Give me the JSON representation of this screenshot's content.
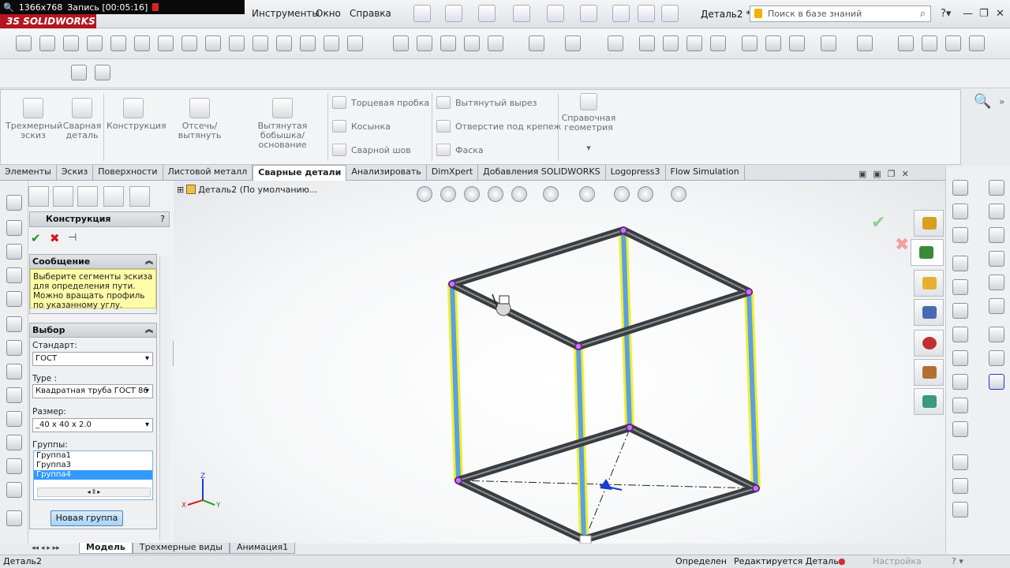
{
  "recorder": {
    "resolution": "1366x768",
    "record_label": "Запись [00:05:16]"
  },
  "app": {
    "brand": "3S SOLIDWORKS"
  },
  "menu": [
    "Инструменты",
    "Окно",
    "Справка"
  ],
  "doc_title": "Деталь2 *",
  "search": {
    "placeholder": "Поиск в базе знаний"
  },
  "command_manager": {
    "big_buttons": [
      {
        "label": "Трехмерный эскиз"
      },
      {
        "label": "Сварная деталь"
      },
      {
        "label": "Конструкция"
      },
      {
        "label": "Отсечь/вытянуть"
      },
      {
        "label": "Вытянутая бобышка/основание"
      }
    ],
    "col1": [
      "Торцевая пробка",
      "Косынка",
      "Сварной шов"
    ],
    "col2": [
      "Вытянутый вырез",
      "Отверстие под крепеж",
      "Фаска"
    ],
    "ref_geom": "Справочная геометрия"
  },
  "tabs": [
    "Элементы",
    "Эскиз",
    "Поверхности",
    "Листовой металл",
    "Сварные детали",
    "Анализировать",
    "DimXpert",
    "Добавления SOLIDWORKS",
    "Logopress3",
    "Flow Simulation"
  ],
  "active_tab": "Сварные детали",
  "property_manager": {
    "title": "Конструкция",
    "message_header": "Сообщение",
    "message": "Выберите сегменты эскиза для определения пути. Можно вращать профиль по указанному углу.",
    "selection_header": "Выбор",
    "standard_label": "Стандарт:",
    "standard_value": "ГОСТ",
    "type_label": "Type :",
    "type_value": "Квадратная труба ГОСТ 86",
    "size_label": "Размер:",
    "size_value": "_40 x 40 x 2.0",
    "groups_label": "Группы:",
    "groups": [
      "Группа1",
      "Группа3",
      "Группа4"
    ],
    "selected_group": "Группа4",
    "new_group_button": "Новая группа"
  },
  "feature_tree": {
    "item": "Деталь2 (По умолчанию..."
  },
  "bottom_tabs": [
    "Модель",
    "Трехмерные виды",
    "Анимация1"
  ],
  "status": {
    "left": "Деталь2",
    "state": "Определен",
    "editing": "Редактируется Деталь",
    "settings": "Настройка"
  },
  "colors": {
    "accent": "#b4151e",
    "frame": "#3a3d40",
    "highlight": "#f2ee2c",
    "selected_member": "#5aa0e6"
  }
}
